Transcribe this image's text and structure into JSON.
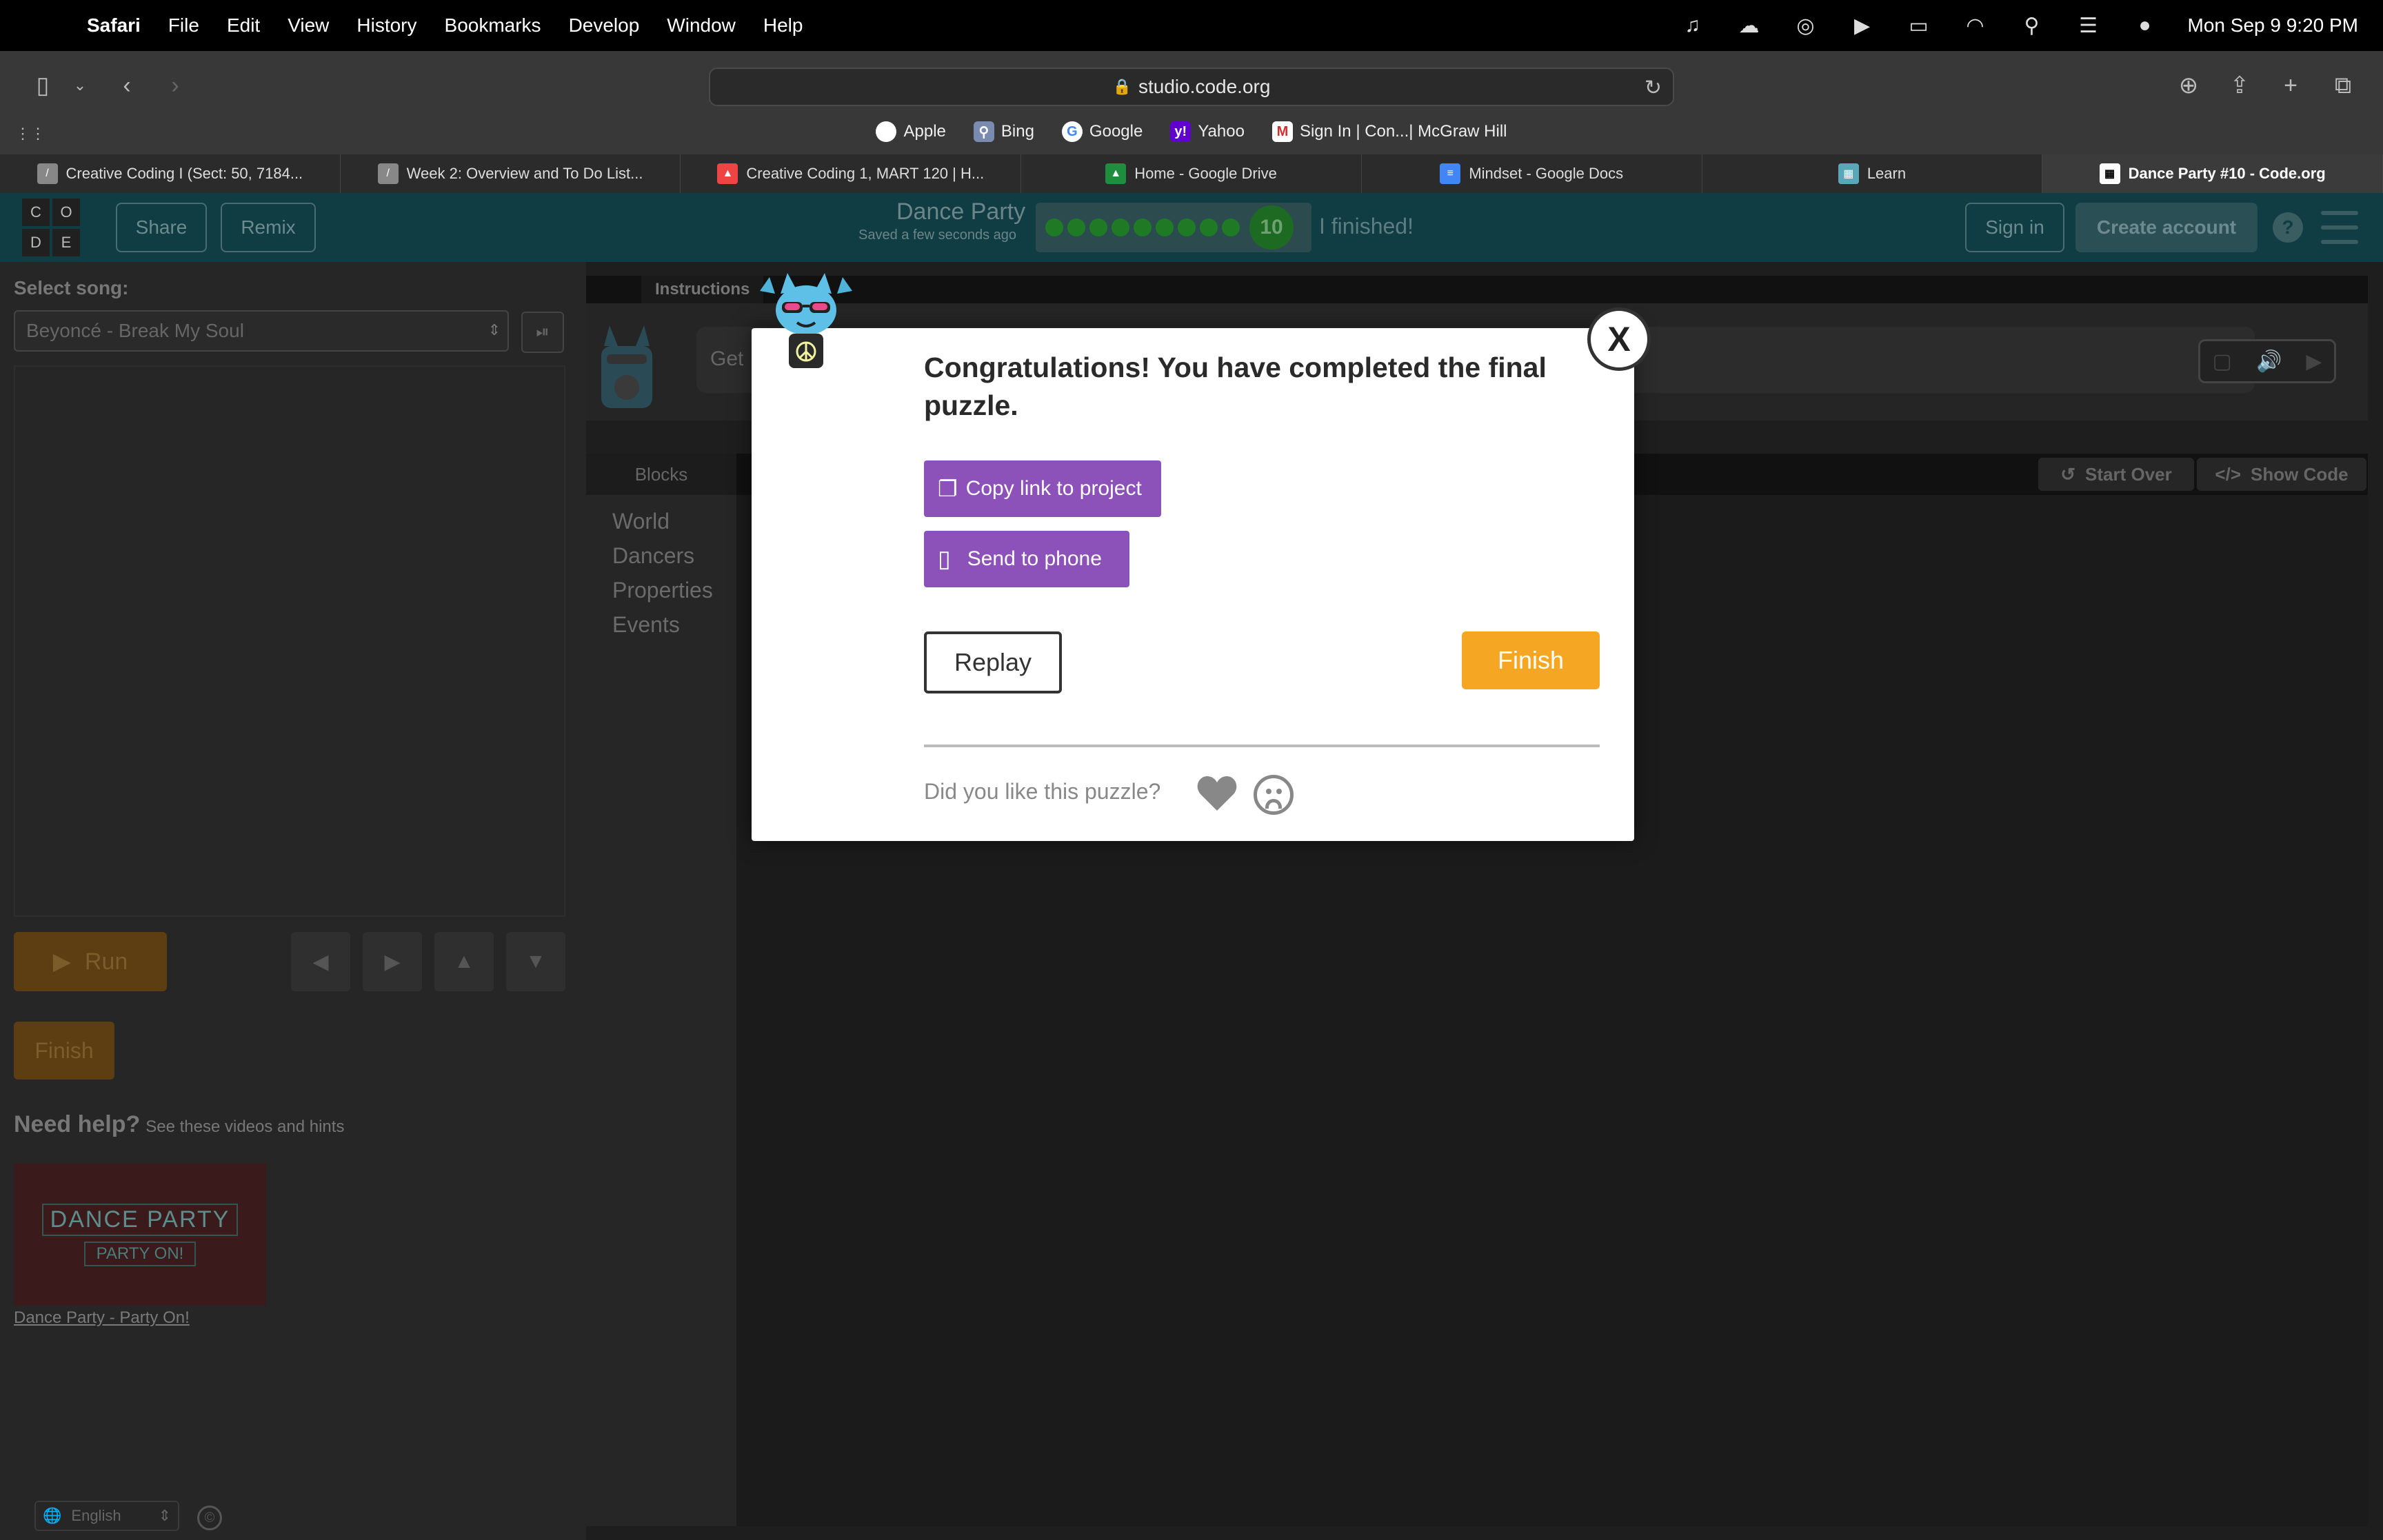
{
  "menubar": {
    "app": "Safari",
    "items": [
      "File",
      "Edit",
      "View",
      "History",
      "Bookmarks",
      "Develop",
      "Window",
      "Help"
    ],
    "datetime": "Mon Sep 9  9:20 PM"
  },
  "browser": {
    "url": "studio.code.org",
    "favorites": [
      "Apple",
      "Bing",
      "Google",
      "Yahoo",
      "Sign In | Con...| McGraw Hill"
    ],
    "tabs": [
      "Creative Coding I (Sect: 50, 7184...",
      "Week 2: Overview and To Do List...",
      "Creative Coding 1, MART 120 | H...",
      "Home - Google Drive",
      "Mindset - Google Docs",
      "Learn",
      "Dance Party #10 - Code.org"
    ]
  },
  "codeorg_header": {
    "logo_letters": [
      "C",
      "O",
      "D",
      "E"
    ],
    "share": "Share",
    "remix": "Remix",
    "title": "Dance Party",
    "saved": "Saved a few seconds ago",
    "level": "10",
    "finished": "I finished!",
    "sign_in": "Sign in",
    "create_account": "Create account",
    "help": "?"
  },
  "left_panel": {
    "select_song_label": "Select song:",
    "song": "Beyoncé - Break My Soul",
    "run": "Run",
    "finish": "Finish",
    "need_help": "Need help?",
    "need_help_sub": "See these videos and hints",
    "video_title_1": "DANCE PARTY",
    "video_title_2": "PARTY ON!",
    "video_link": "Dance Party - Party On!",
    "language": "English"
  },
  "workspace": {
    "instructions_label": "Instructions",
    "instructions_text": "Get",
    "blocks_label": "Blocks",
    "start_over": "Start Over",
    "show_code": "Show Code",
    "categories": [
      "World",
      "Dancers",
      "Properties",
      "Events"
    ]
  },
  "modal": {
    "title": "Congratulations! You have completed the final puzzle.",
    "copy_link": "Copy link to project",
    "send_to_phone": "Send to phone",
    "replay": "Replay",
    "finish": "Finish",
    "feedback_question": "Did you like this puzzle?",
    "close": "X"
  },
  "colors": {
    "purple": "#8c52ba",
    "orange": "#f5a623",
    "header_teal": "#0f3d43"
  }
}
